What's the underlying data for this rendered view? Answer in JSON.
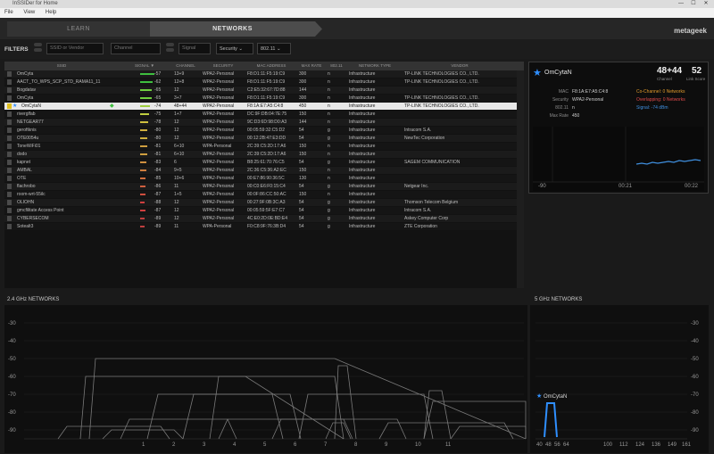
{
  "window": {
    "title": "InSSIDer for Home",
    "min": "—",
    "max": "☐",
    "close": "✕"
  },
  "menu": [
    "File",
    "View",
    "Help"
  ],
  "nav": {
    "learn": "LEARN",
    "networks": "NETWORKS",
    "brand": "metageek"
  },
  "filters": {
    "label": "FILTERS",
    "ssid_placeholder": "SSID or Vendor",
    "channel_placeholder": "Channel",
    "signal_placeholder": "Signal",
    "security": "Security",
    "standard": "802.11"
  },
  "table": {
    "headers": [
      "SSID",
      "SIGNAL ▼",
      "CHANNEL",
      "SECURITY",
      "MAC ADDRESS",
      "MAX RATE",
      "802.11",
      "NETWORK TYPE",
      "VENDOR"
    ],
    "rows": [
      {
        "ssid": "OmCyta",
        "signal": "-57",
        "channel": "13+9",
        "security": "WPA2-Personal",
        "mac": "F8:D1:11:F5:19:C9",
        "rate": "300",
        "std": "n",
        "type": "Infrastructure",
        "vendor": "TP-LINK TECHNOLOGIES CO., LTD.",
        "bar": "#3fbf3f",
        "sigfrac": 0.8
      },
      {
        "ssid": "AACT_TO_WPS_SCP_STD_RAMA11_11",
        "signal": "-62",
        "channel": "12+8",
        "security": "WPA2-Personal",
        "mac": "F8:D1:11:F5:19:C9",
        "rate": "300",
        "std": "n",
        "type": "Infrastructure",
        "vendor": "TP-LINK TECHNOLOGIES CO., LTD.",
        "bar": "#3fbf3f",
        "sigfrac": 0.72
      },
      {
        "ssid": "Bogdatav",
        "signal": "-65",
        "channel": "12",
        "security": "WPA2-Personal",
        "mac": "C2:E5:32:67:7D:88",
        "rate": "144",
        "std": "n",
        "type": "Infrastructure",
        "vendor": "",
        "bar": "#6fcf3f",
        "sigfrac": 0.65
      },
      {
        "ssid": "OmCyta",
        "signal": "-65",
        "channel": "3+7",
        "security": "WPA2-Personal",
        "mac": "F8:D1:11:F5:19:C9",
        "rate": "300",
        "std": "n",
        "type": "Infrastructure",
        "vendor": "TP-LINK TECHNOLOGIES CO., LTD.",
        "bar": "#6fcf3f",
        "sigfrac": 0.65
      },
      {
        "ssid": "OmCytaN",
        "signal": "-74",
        "channel": "48+44",
        "security": "WPA2-Personal",
        "mac": "F8:1A:E7:A5:C4:8",
        "rate": "450",
        "std": "n",
        "type": "Infrastructure",
        "vendor": "TP-LINK TECHNOLOGIES CO., LTD.",
        "bar": "#9fcf3f",
        "sigfrac": 0.55,
        "selected": true
      },
      {
        "ssid": "riverglfab",
        "signal": "-75",
        "channel": "1+7",
        "security": "WPA2-Personal",
        "mac": "DC:9F:DB:04:7E:75",
        "rate": "150",
        "std": "n",
        "type": "Infrastructure",
        "vendor": "",
        "bar": "#bfcf3f",
        "sigfrac": 0.5
      },
      {
        "ssid": "NETGEAR77",
        "signal": "-78",
        "channel": "12",
        "security": "WPA2-Personal",
        "mac": "9C:D3:6D:98:D0:A3",
        "rate": "144",
        "std": "n",
        "type": "Infrastructure",
        "vendor": "",
        "bar": "#cfbf3f",
        "sigfrac": 0.45
      },
      {
        "ssid": "geroftknis",
        "signal": "-80",
        "channel": "12",
        "security": "WPA2-Personal",
        "mac": "00:05:59:32:C5:D2",
        "rate": "54",
        "std": "g",
        "type": "Infrastructure",
        "vendor": "Intracom S.A.",
        "bar": "#cfaf3f",
        "sigfrac": 0.42
      },
      {
        "ssid": "OTE0054u",
        "signal": "-80",
        "channel": "12",
        "security": "WPA2-Personal",
        "mac": "00:12:2B:47:E3:DD",
        "rate": "54",
        "std": "g",
        "type": "Infrastructure",
        "vendor": "NewTec Corporation",
        "bar": "#cfaf3f",
        "sigfrac": 0.42
      },
      {
        "ssid": "ToneWiFi01",
        "signal": "-81",
        "channel": "6+10",
        "security": "WPA-Personal",
        "mac": "2C:39:C5:2D:17:A6",
        "rate": "150",
        "std": "n",
        "type": "Infrastructure",
        "vendor": "",
        "bar": "#cf9f3f",
        "sigfrac": 0.4
      },
      {
        "ssid": "dodo",
        "signal": "-81",
        "channel": "6+10",
        "security": "WPA2-Personal",
        "mac": "2C:39:C5:2D:17:A6",
        "rate": "150",
        "std": "n",
        "type": "Infrastructure",
        "vendor": "",
        "bar": "#cf9f3f",
        "sigfrac": 0.4
      },
      {
        "ssid": "kapnet",
        "signal": "-83",
        "channel": "6",
        "security": "WPA2-Personal",
        "mac": "B8:25:61:70:76:C5",
        "rate": "54",
        "std": "g",
        "type": "Infrastructure",
        "vendor": "SAGEM COMMUNICATION",
        "bar": "#cf8f3f",
        "sigfrac": 0.36
      },
      {
        "ssid": "AMBAL",
        "signal": "-84",
        "channel": "9+5",
        "security": "WPA2-Personal",
        "mac": "2C:36:C5:36:A2:EC",
        "rate": "150",
        "std": "n",
        "type": "Infrastructure",
        "vendor": "",
        "bar": "#cf7f3f",
        "sigfrac": 0.34
      },
      {
        "ssid": "OTE",
        "signal": "-85",
        "channel": "10+6",
        "security": "WPA2-Personal",
        "mac": "00:E7:86:90:36:5C",
        "rate": "130",
        "std": "n",
        "type": "Infrastructure",
        "vendor": "",
        "bar": "#cf6f3f",
        "sigfrac": 0.32
      },
      {
        "ssid": "flachrobo",
        "signal": "-86",
        "channel": "11",
        "security": "WPA2-Personal",
        "mac": "00:C0:E6:F0:15:C4",
        "rate": "54",
        "std": "g",
        "type": "Infrastructure",
        "vendor": "Netgear Inc.",
        "bar": "#cf5f3f",
        "sigfrac": 0.3
      },
      {
        "ssid": "room-wrt-55ilc",
        "signal": "-87",
        "channel": "1+5",
        "security": "WPA2-Personal",
        "mac": "00:0F:86:CC:50:AC",
        "rate": "150",
        "std": "n",
        "type": "Infrastructure",
        "vendor": "",
        "bar": "#cf4f3f",
        "sigfrac": 0.28
      },
      {
        "ssid": "OLIOHN",
        "signal": "-88",
        "channel": "12",
        "security": "WPA2-Personal",
        "mac": "00:27:9F:0B:3C:A3",
        "rate": "54",
        "std": "g",
        "type": "Infrastructure",
        "vendor": "Thomson Telecom Belgium",
        "bar": "#cf3f3f",
        "sigfrac": 0.26
      },
      {
        "ssid": "gmcfilitate Access Point",
        "signal": "-87",
        "channel": "12",
        "security": "WPA2-Personal",
        "mac": "00:05:59:5F:E7:C7",
        "rate": "54",
        "std": "g",
        "type": "Infrastructure",
        "vendor": "Intracom S.A.",
        "bar": "#cf3f3f",
        "sigfrac": 0.28
      },
      {
        "ssid": "CYBERSECOM",
        "signal": "-89",
        "channel": "12",
        "security": "WPA2-Personal",
        "mac": "4C:E0:2D:0E:BD:E4",
        "rate": "54",
        "std": "g",
        "type": "Infrastructure",
        "vendor": "Askey Computer Corp",
        "bar": "#bf3f3f",
        "sigfrac": 0.24
      },
      {
        "ssid": "Sotealt3",
        "signal": "-89",
        "channel": "11",
        "security": "WPA-Personal",
        "mac": "F0:C8:9F:76:3B:D4",
        "rate": "54",
        "std": "g",
        "type": "Infrastructure",
        "vendor": "ZTE Corporation",
        "bar": "#bf3f3f",
        "sigfrac": 0.24
      }
    ]
  },
  "details": {
    "ssid": "OmCytaN",
    "channel": "48+44",
    "signal": "52",
    "channel_sub": "Channel",
    "signal_sub": "Link Score",
    "fields": [
      {
        "label": "MAC",
        "value": "F8:1A:E7:A5:C4:8"
      },
      {
        "label": "Security",
        "value": "WPA2-Personal"
      },
      {
        "label": "802.11",
        "value": "n"
      },
      {
        "label": "Max Rate",
        "value": "450"
      }
    ],
    "alerts": [
      {
        "text": "Co-Channel: 0 Networks",
        "color": "#e09a2c"
      },
      {
        "text": "Overlapping: 0 Networks",
        "color": "#e04a4a"
      },
      {
        "text": "Signal: -74 dBm",
        "color": "#3f8fdf"
      }
    ],
    "graph_ticks": [
      "-90",
      "00:21",
      "00:22"
    ]
  },
  "band24": {
    "title": "2.4 GHz NETWORKS",
    "yticks": [
      "-30",
      "-40",
      "-50",
      "-60",
      "-70",
      "-80",
      "-90"
    ],
    "xticks": [
      "1",
      "2",
      "3",
      "4",
      "5",
      "6",
      "7",
      "8",
      "9",
      "10",
      "11"
    ]
  },
  "band5": {
    "title": "5 GHz NETWORKS",
    "yticks": [
      "-30",
      "-40",
      "-50",
      "-60",
      "-70",
      "-80",
      "-90"
    ],
    "xticks": [
      "40",
      "48",
      "56",
      "64",
      "100",
      "112",
      "124",
      "136",
      "149",
      "161"
    ],
    "network": "OmCytaN"
  },
  "colors": {
    "selected_row": "#e8e8e8",
    "accent_blue": "#2f8fff",
    "badge_yellow": "#e0c020"
  }
}
